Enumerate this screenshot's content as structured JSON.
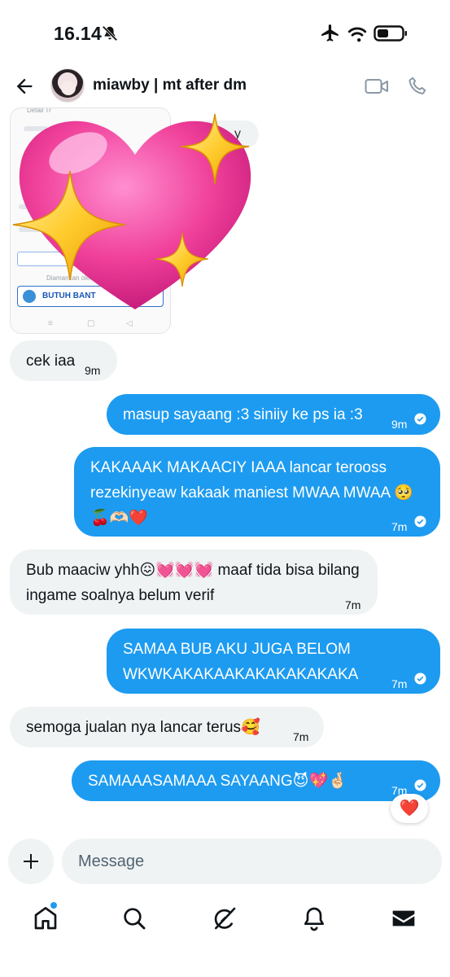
{
  "status_bar": {
    "time": "16.14"
  },
  "header": {
    "title": "miawby | mt after dm"
  },
  "shared_image": {
    "label_detail": "Detail Tr",
    "label_diamankan": "Diamankan oleh",
    "help_button": "BUTUH BANT",
    "peek_text": "y"
  },
  "messages": [
    {
      "side": "in",
      "text": "cek iaa",
      "time": "9m"
    },
    {
      "side": "out",
      "text": "masup sayaang :3 siniiy ke ps ia :3",
      "time": "9m"
    },
    {
      "side": "out",
      "text": "KAKAAAK MAKAACIY IAAA lancar terooss rezekinyeaw kakaak maniest MWAA MWAA 🥺🍒🫶🏻❤️",
      "time": "7m"
    },
    {
      "side": "in",
      "text": "Bub maaciw yhh😖💓💓💓 maaf tida bisa bilang ingame soalnya belum verif",
      "time": "7m"
    },
    {
      "side": "out",
      "text": "SAMAA BUB AKU JUGA BELOM WKWKAKAKAAKAKAKAKAKAKA",
      "time": "7m"
    },
    {
      "side": "in",
      "text": "semoga jualan nya lancar terus🥰",
      "time": "7m"
    },
    {
      "side": "out",
      "text": "SAMAAASAMAAA SAYAANG😈💖🤞🏻",
      "time": "7m"
    }
  ],
  "reaction": "❤️",
  "composer": {
    "placeholder": "Message"
  },
  "colors": {
    "accent": "#1d9bf0",
    "incoming_bubble": "#eff3f4",
    "text": "#0f1419"
  },
  "icons": {
    "status": [
      "mute-icon",
      "airplane-icon",
      "wifi-icon",
      "battery-icon"
    ],
    "header": [
      "back-icon",
      "video-call-icon",
      "phone-call-icon"
    ],
    "nav": [
      "home-icon",
      "search-icon",
      "grok-icon",
      "notifications-icon",
      "messages-icon"
    ]
  }
}
